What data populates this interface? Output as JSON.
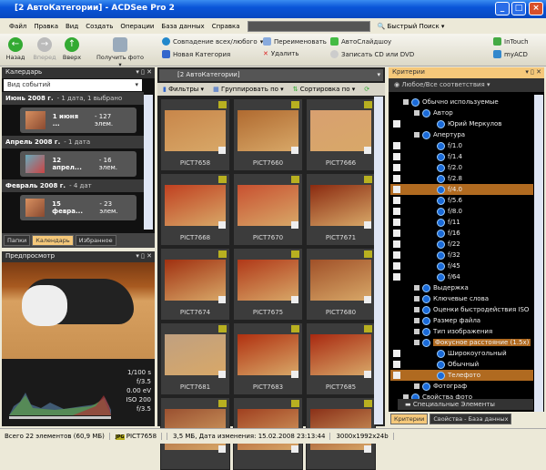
{
  "window": {
    "title": "[2 АвтоКатегории] - ACDSee Pro 2"
  },
  "menu": [
    "Файл",
    "Правка",
    "Вид",
    "Создать",
    "Операции",
    "База данных",
    "Справка"
  ],
  "quick_search": "Быстрый Поиск",
  "toolbar": {
    "back": "Назад",
    "forward": "Вперед",
    "up": "Вверх",
    "get_photos": "Получить фото",
    "match": "Совпадение всех/любого",
    "new_category": "Новая Категория",
    "rename": "Переименовать",
    "delete": "Удалить",
    "slideshow": "АвтоСлайдшоу",
    "burn": "Записать CD или DVD",
    "intouch": "InTouch",
    "myacd": "myACD"
  },
  "calendar": {
    "title": "Калердарь",
    "view": "Вид событий",
    "months": [
      {
        "name": "Июнь 2008 г.",
        "info": "- 1 дата, 1 выбрано",
        "day": "1 июня ...",
        "count": "- 127 элем."
      },
      {
        "name": "Апрель 2008 г.",
        "info": "- 1 дата",
        "day": "12 апрел...",
        "count": "- 16 элем."
      },
      {
        "name": "Февраль 2008 г.",
        "info": "- 4 дат",
        "day": "15 февра...",
        "count": "- 23 элем."
      }
    ],
    "tabs": [
      "Папки",
      "Календарь",
      "Избранное"
    ]
  },
  "preview": {
    "title": "Предпросмотр",
    "exif": [
      "1/100 s",
      "f/3.5",
      "0.00 eV",
      "ISO 200",
      "f/3.5"
    ]
  },
  "browser": {
    "path": "[2 АвтоКатегории]",
    "filters": "Фильтры",
    "group": "Группировать по",
    "sort": "Сортировка по",
    "files": [
      "PICT7658",
      "PICT7660",
      "PICT7666",
      "PICT7668",
      "PICT7670",
      "PICT7671",
      "PICT7674",
      "PICT7675",
      "PICT7680",
      "PICT7681",
      "PICT7683",
      "PICT7685",
      "",
      "",
      ""
    ]
  },
  "criteria": {
    "title": "Критерии",
    "match": "Любое/Все соответствия",
    "items": [
      "Обычно используемые",
      "Автор",
      "Юрий Меркулов",
      "Апертура",
      "f/1.0",
      "f/1.4",
      "f/2.0",
      "f/2.8",
      "f/4.0",
      "f/5.6",
      "f/8.0",
      "f/11",
      "f/16",
      "f/22",
      "f/32",
      "f/45",
      "f/64",
      "Выдержка",
      "Ключевые слова",
      "Оценки быстродействия ISO",
      "Размер файла",
      "Тип изображения",
      "Фокусное расстояние (1.5x)",
      "Широкоугольный",
      "Обычный",
      "Телефото",
      "Фотограф",
      "Свойства фото"
    ],
    "special": "Специальные Элементы",
    "tabs": [
      "Критерии",
      "Свойства - База данных"
    ]
  },
  "status": {
    "total": "Всего 22 элементов  (60,9 МБ)",
    "file": "PICT7658",
    "info": "3,5 МБ, Дата изменения: 15.02.2008 23:13:44",
    "dims": "3000x1992x24b"
  }
}
